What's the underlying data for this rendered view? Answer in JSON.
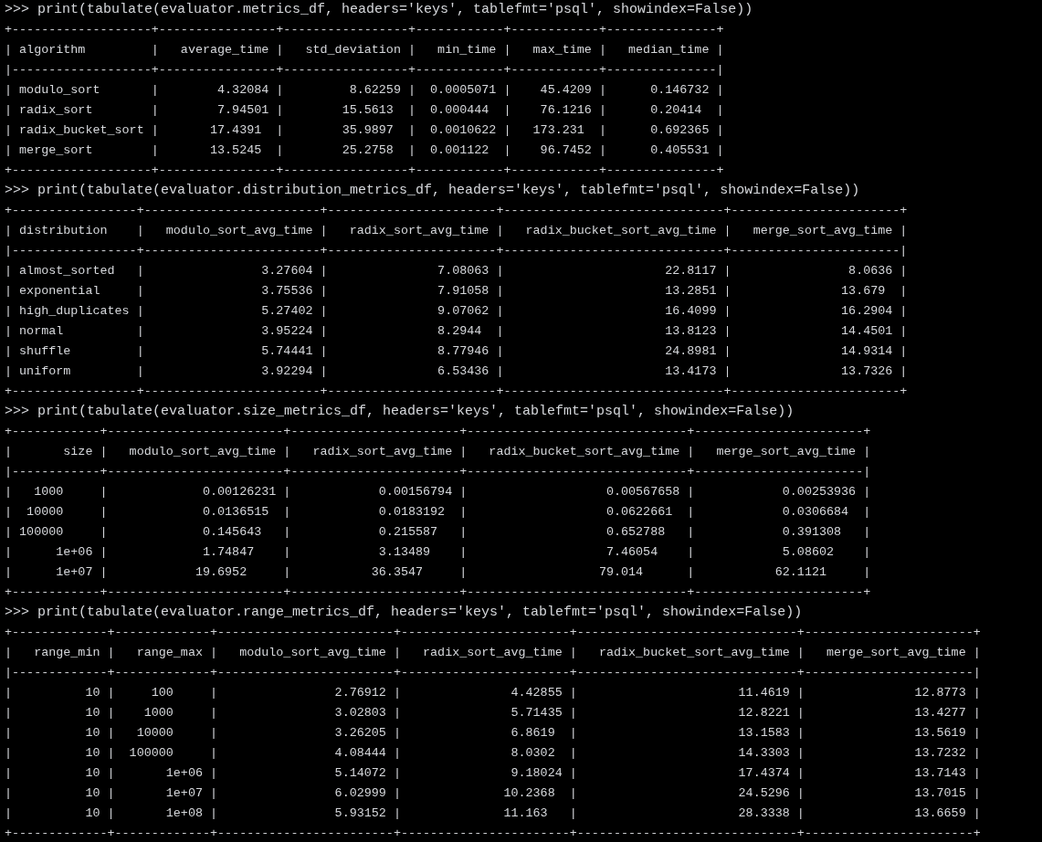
{
  "blocks": [
    {
      "command": ">>> print(tabulate(evaluator.metrics_df, headers='keys', tablefmt='psql', showindex=False))",
      "output": [
        "+-------------------+----------------+-----------------+------------+------------+---------------+",
        "| algorithm         |   average_time |   std_deviation |   min_time |   max_time |   median_time |",
        "|-------------------+----------------+-----------------+------------+------------+---------------|",
        "| modulo_sort       |        4.32084 |         8.62259 |  0.0005071 |    45.4209 |      0.146732 |",
        "| radix_sort        |        7.94501 |        15.5613  |  0.000444  |    76.1216 |      0.20414  |",
        "| radix_bucket_sort |       17.4391  |        35.9897  |  0.0010622 |   173.231  |      0.692365 |",
        "| merge_sort        |       13.5245  |        25.2758  |  0.001122  |    96.7452 |      0.405531 |",
        "+-------------------+----------------+-----------------+------------+------------+---------------+"
      ]
    },
    {
      "command": ">>> print(tabulate(evaluator.distribution_metrics_df, headers='keys', tablefmt='psql', showindex=False))",
      "output": [
        "+-----------------+------------------------+-----------------------+------------------------------+-----------------------+",
        "| distribution    |   modulo_sort_avg_time |   radix_sort_avg_time |   radix_bucket_sort_avg_time |   merge_sort_avg_time |",
        "|-----------------+------------------------+-----------------------+------------------------------+-----------------------|",
        "| almost_sorted   |                3.27604 |               7.08063 |                      22.8117 |                8.0636 |",
        "| exponential     |                3.75536 |               7.91058 |                      13.2851 |               13.679  |",
        "| high_duplicates |                5.27402 |               9.07062 |                      16.4099 |               16.2904 |",
        "| normal          |                3.95224 |               8.2944  |                      13.8123 |               14.4501 |",
        "| shuffle         |                5.74441 |               8.77946 |                      24.8981 |               14.9314 |",
        "| uniform         |                3.92294 |               6.53436 |                      13.4173 |               13.7326 |",
        "+-----------------+------------------------+-----------------------+------------------------------+-----------------------+"
      ]
    },
    {
      "command": ">>> print(tabulate(evaluator.size_metrics_df, headers='keys', tablefmt='psql', showindex=False))",
      "output": [
        "+------------+------------------------+-----------------------+------------------------------+-----------------------+",
        "|       size |   modulo_sort_avg_time |   radix_sort_avg_time |   radix_bucket_sort_avg_time |   merge_sort_avg_time |",
        "|------------+------------------------+-----------------------+------------------------------+-----------------------|",
        "|   1000     |             0.00126231 |            0.00156794 |                   0.00567658 |            0.00253936 |",
        "|  10000     |             0.0136515  |            0.0183192  |                   0.0622661  |            0.0306684  |",
        "| 100000     |             0.145643   |            0.215587   |                   0.652788   |            0.391308   |",
        "|      1e+06 |             1.74847    |            3.13489    |                   7.46054    |            5.08602    |",
        "|      1e+07 |            19.6952     |           36.3547     |                  79.014      |           62.1121     |",
        "+------------+------------------------+-----------------------+------------------------------+-----------------------+"
      ]
    },
    {
      "command": ">>> print(tabulate(evaluator.range_metrics_df, headers='keys', tablefmt='psql', showindex=False))",
      "output": [
        "+-------------+-------------+------------------------+-----------------------+------------------------------+-----------------------+",
        "|   range_min |   range_max |   modulo_sort_avg_time |   radix_sort_avg_time |   radix_bucket_sort_avg_time |   merge_sort_avg_time |",
        "|-------------+-------------+------------------------+-----------------------+------------------------------+-----------------------|",
        "|          10 |     100     |                2.76912 |               4.42855 |                      11.4619 |               12.8773 |",
        "|          10 |    1000     |                3.02803 |               5.71435 |                      12.8221 |               13.4277 |",
        "|          10 |   10000     |                3.26205 |               6.8619  |                      13.1583 |               13.5619 |",
        "|          10 |  100000     |                4.08444 |               8.0302  |                      14.3303 |               13.7232 |",
        "|          10 |       1e+06 |                5.14072 |               9.18024 |                      17.4374 |               13.7143 |",
        "|          10 |       1e+07 |                6.02999 |              10.2368  |                      24.5296 |               13.7015 |",
        "|          10 |       1e+08 |                5.93152 |              11.163   |                      28.3338 |               13.6659 |",
        "+-------------+-------------+------------------------+-----------------------+------------------------------+-----------------------+"
      ]
    }
  ]
}
